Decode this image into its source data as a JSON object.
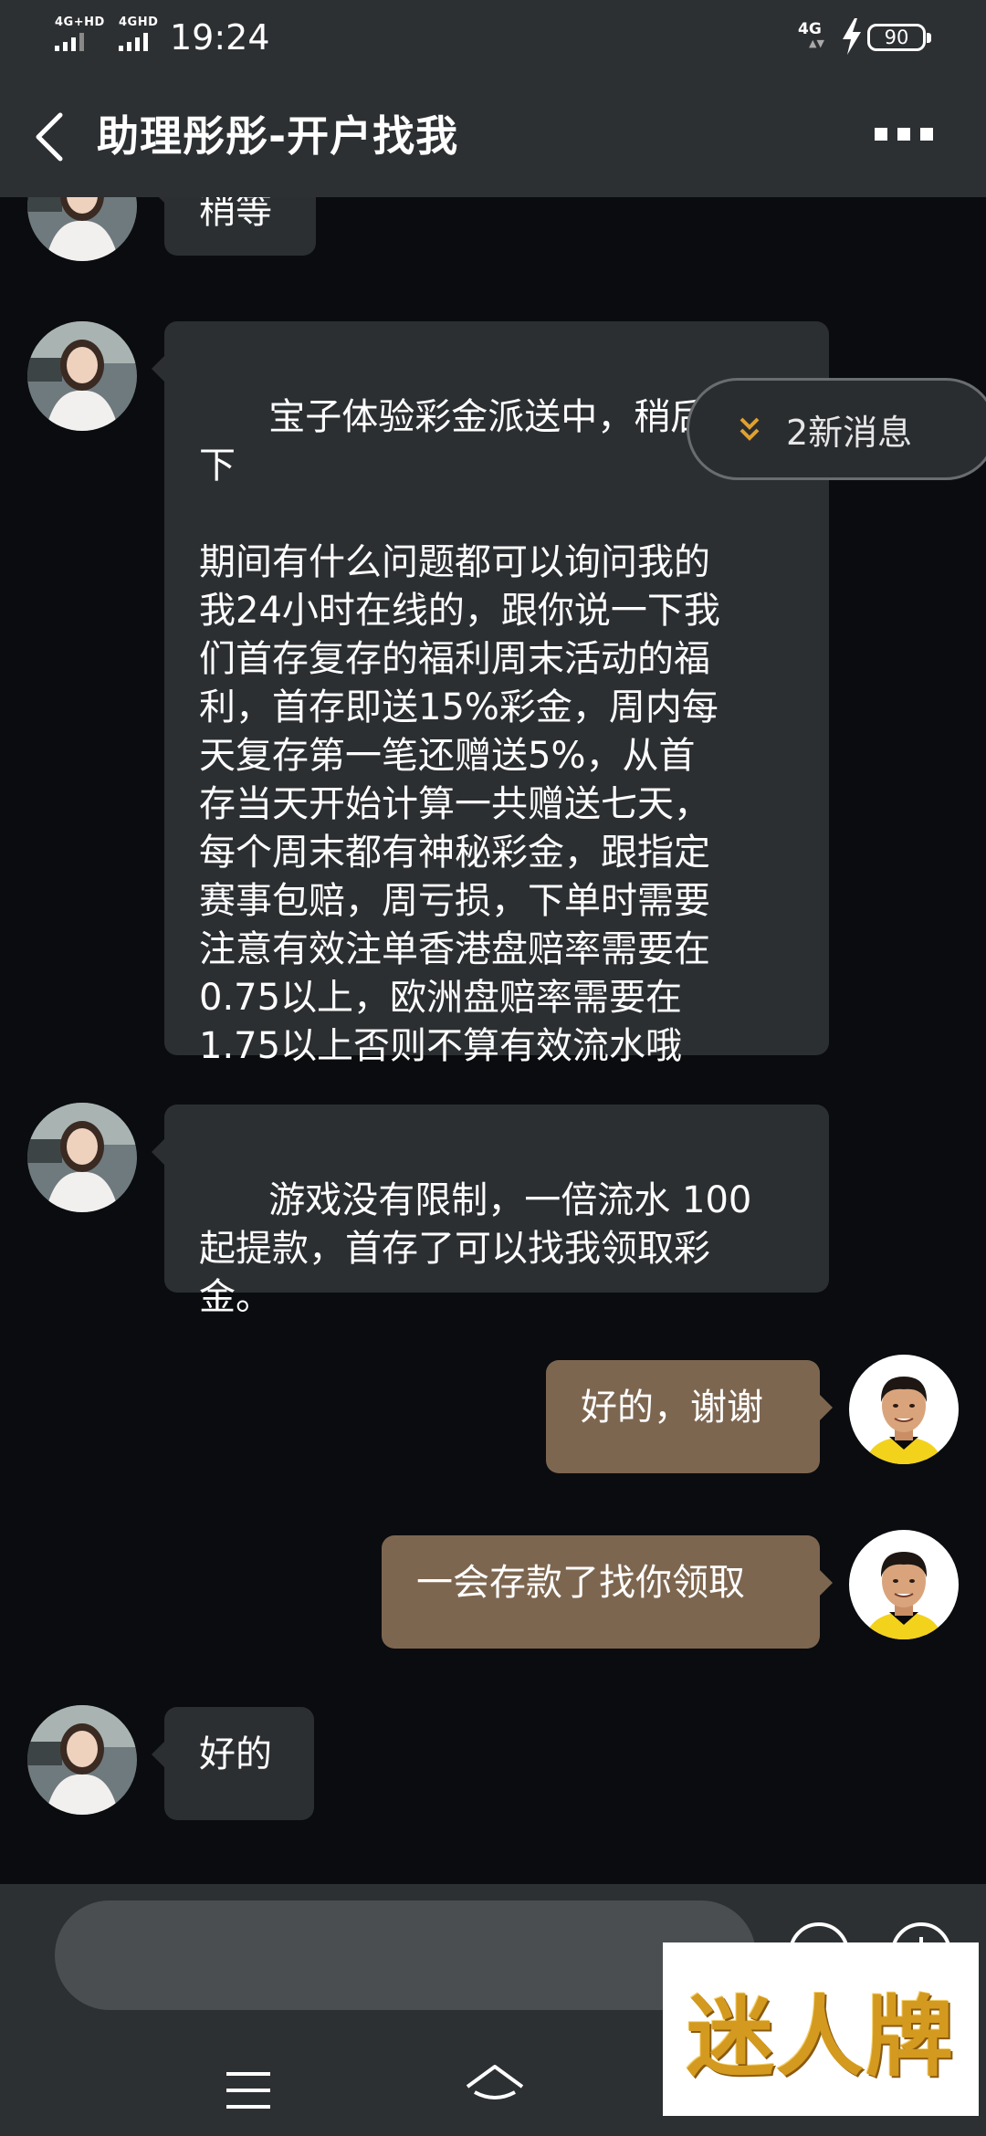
{
  "status_bar": {
    "network_left_1": "4G+HD",
    "network_left_2": "4GHD",
    "time": "19:24",
    "network_right": "4G",
    "battery": "90"
  },
  "header": {
    "title": "助理彤彤-开户找我"
  },
  "new_messages": {
    "label": "2新消息"
  },
  "messages": [
    {
      "side": "left",
      "text": "稍等"
    },
    {
      "side": "left",
      "text": "宝子体验彩金派送中，稍后刷新\n下\n\n期间有什么问题都可以询问我的\n我24小时在线的，跟你说一下我\n们首存复存的福利周末活动的福\n利，首存即送15%彩金，周内每\n天复存第一笔还赠送5%，从首\n存当天开始计算一共赠送七天，\n每个周末都有神秘彩金，跟指定\n赛事包赔，周亏损，下单时需要\n注意有效注单香港盘赔率需要在\n0.75以上，欧洲盘赔率需要在\n1.75以上否则不算有效流水哦"
    },
    {
      "side": "left",
      "text": "游戏没有限制，一倍流水 100\n起提款，首存了可以找我领取彩\n金。"
    },
    {
      "side": "right",
      "text": "好的，谢谢"
    },
    {
      "side": "right",
      "text": "一会存款了找你领取"
    },
    {
      "side": "left",
      "text": "好的"
    }
  ],
  "input": {
    "value": "",
    "placeholder": ""
  },
  "watermark": {
    "text": "迷人牌"
  },
  "colors": {
    "background": "#0a0c0f",
    "bar": "#2d3033",
    "bubble_left": "#2c2f32",
    "bubble_right": "#7d6650",
    "accent_chevron": "#e0a030"
  }
}
